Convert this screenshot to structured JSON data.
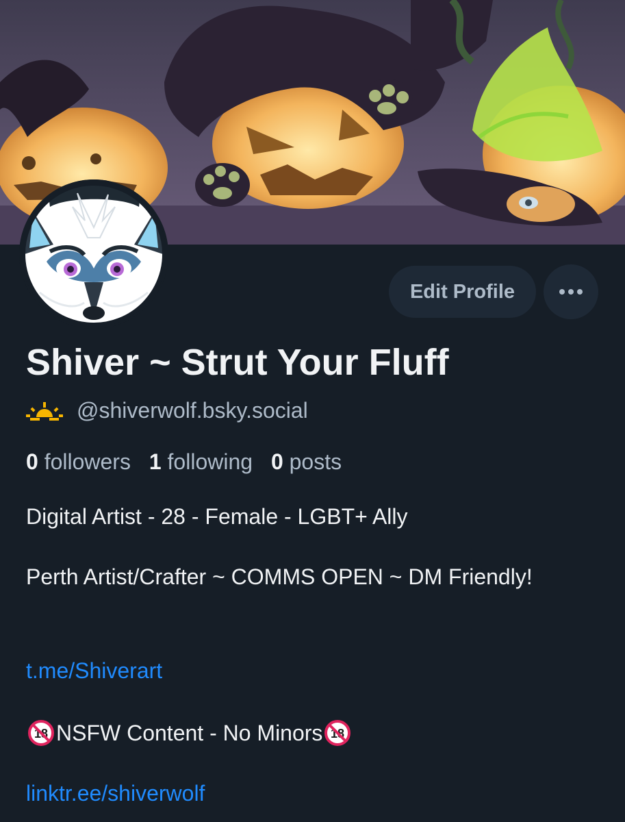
{
  "profile": {
    "display_name": "Shiver ~ Strut Your Fluff",
    "handle": "@shiverwolf.bsky.social",
    "handle_icon": "sunrise-emoji"
  },
  "actions": {
    "edit_label": "Edit Profile",
    "more_icon": "ellipsis-icon"
  },
  "stats": {
    "followers_count": "0",
    "followers_label": "followers",
    "following_count": "1",
    "following_label": "following",
    "posts_count": "0",
    "posts_label": "posts"
  },
  "bio": {
    "line1": "Digital Artist - 28 - Female  - LGBT+ Ally",
    "line2": "Perth Artist/Crafter ~ COMMS OPEN ~ DM Friendly!",
    "link1": "t.me/Shiverart",
    "nsfw_text": "NSFW Content - No Minors",
    "nsfw_icon": "no-one-under-eighteen-emoji",
    "link2": "linktr.ee/shiverwolf"
  },
  "colors": {
    "background": "#161e27",
    "button_bg": "#1e2936",
    "muted_text": "#aebbc9",
    "link": "#208bfe"
  }
}
